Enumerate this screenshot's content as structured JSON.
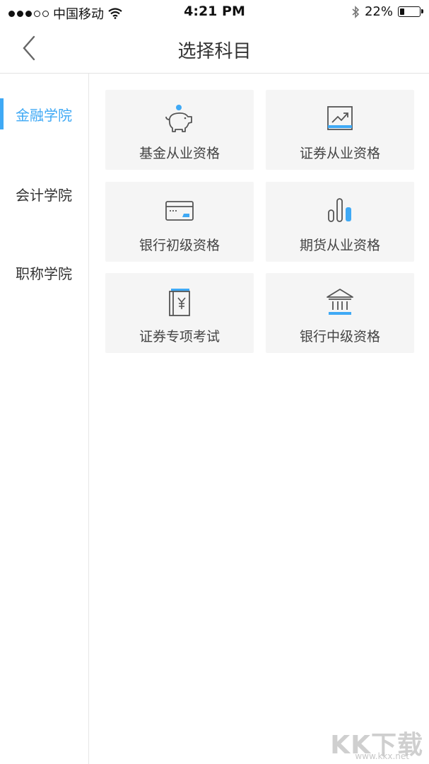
{
  "status_bar": {
    "carrier": "中国移动",
    "time": "4:21 PM",
    "battery": "22%",
    "battery_level": 0.22
  },
  "nav": {
    "title": "选择科目"
  },
  "sidebar": {
    "items": [
      {
        "label": "金融学院",
        "active": true
      },
      {
        "label": "会计学院",
        "active": false
      },
      {
        "label": "职称学院",
        "active": false
      }
    ]
  },
  "subjects": [
    {
      "label": "基金从业资格",
      "icon": "piggy-bank-icon"
    },
    {
      "label": "证券从业资格",
      "icon": "trend-chart-icon"
    },
    {
      "label": "银行初级资格",
      "icon": "credit-card-icon"
    },
    {
      "label": "期货从业资格",
      "icon": "bar-chart-icon"
    },
    {
      "label": "证券专项考试",
      "icon": "yuan-book-icon"
    },
    {
      "label": "银行中级资格",
      "icon": "bank-building-icon"
    }
  ],
  "colors": {
    "accent": "#3fa9f5",
    "card_bg": "#f5f5f5",
    "text": "#444444"
  },
  "watermark": {
    "logo": "KK下载",
    "url": "www.kkx.net"
  }
}
